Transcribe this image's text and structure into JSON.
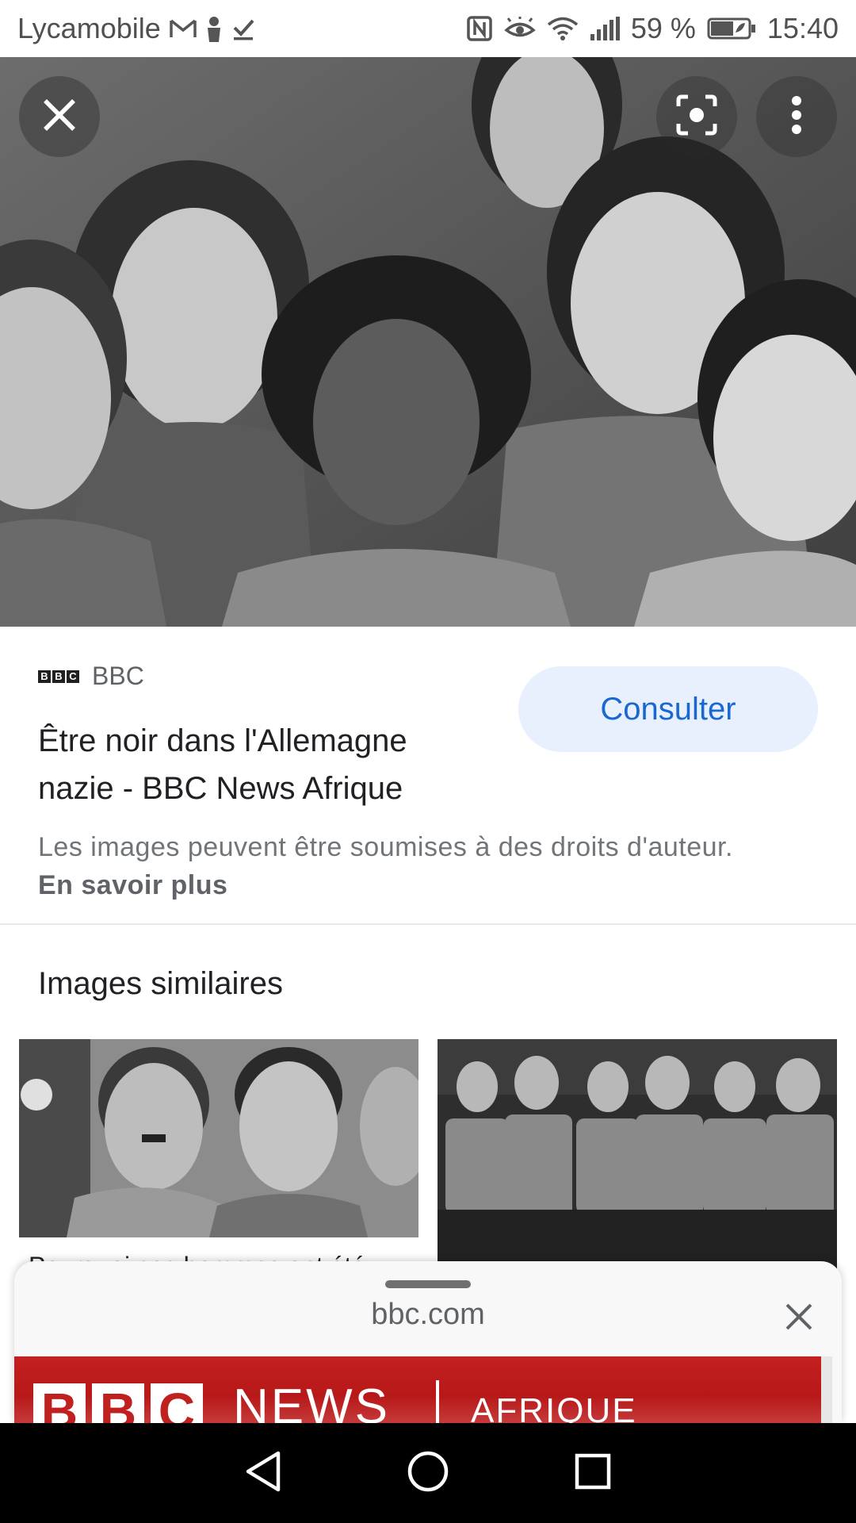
{
  "status_bar": {
    "carrier": "Lycamobile",
    "battery_percent": "59 %",
    "time": "15:40",
    "icons": [
      "gmail-icon",
      "account-icon",
      "download-done-icon",
      "nfc-icon",
      "eye-comfort-icon",
      "wifi-icon",
      "signal-icon",
      "battery-icon"
    ]
  },
  "viewer": {
    "close_icon": "close-icon",
    "lens_icon": "google-lens-icon",
    "more_icon": "more-vert-icon"
  },
  "source": {
    "site_name": "BBC",
    "title": "Être noir dans l'Allemagne nazie - BBC News Afrique",
    "visit_label": "Consulter",
    "rights_text": "Les images peuvent être soumises à des droits d'auteur.",
    "learn_more": "En savoir plus"
  },
  "similar": {
    "heading": "Images similaires",
    "items": [
      {
        "caption": "Pourquoi ces hommes ont été accusés"
      },
      {
        "caption": ""
      }
    ]
  },
  "sheet": {
    "domain": "bbc.com",
    "banner_letters": [
      "B",
      "B",
      "C"
    ],
    "banner_news": "NEWS",
    "banner_region": "AFRIQUE"
  },
  "nav": {
    "icons": [
      "back-icon",
      "home-icon",
      "recents-icon"
    ]
  },
  "colors": {
    "accent": "#1967d2",
    "button_bg": "#e8f0fe",
    "bbc_red": "#bb1919"
  }
}
